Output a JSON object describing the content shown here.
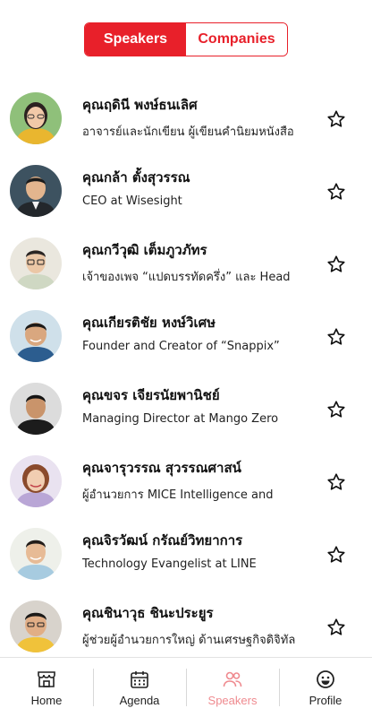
{
  "segment": {
    "speakers_label": "Speakers",
    "companies_label": "Companies"
  },
  "speakers": [
    {
      "name": "คุณฤดินี พงษ์ธนเลิศ",
      "desc": "อาจารย์และนักเขียน ผู้เขียนคำนิยมหนังสือ",
      "icon": "avatar-woman-glasses"
    },
    {
      "name": "คุณกล้า ตั้งสุวรรณ",
      "desc": "CEO at Wisesight",
      "icon": "avatar-man-suit"
    },
    {
      "name": "คุณกวีวุฒิ เต็มภูวภัทร",
      "desc": "เจ้าของเพจ “แปดบรรทัดครึ่ง” และ Head",
      "icon": "avatar-man-glasses"
    },
    {
      "name": "คุณเกียรติชัย หงษ์วิเศษ",
      "desc": "Founder and Creator of “Snappix”",
      "icon": "avatar-man-smiling"
    },
    {
      "name": "คุณขจร เจียรนัยพานิชย์",
      "desc": "Managing Director at Mango Zero",
      "icon": "avatar-man-dark"
    },
    {
      "name": "คุณจารุวรรณ สุวรรณศาสน์",
      "desc": "ผู้อำนวยการ MICE Intelligence and",
      "icon": "avatar-woman-smiling"
    },
    {
      "name": "คุณจิรวัฒน์ กรัณย์วิทยาการ",
      "desc": "Technology Evangelist at LINE",
      "icon": "avatar-man-casual"
    },
    {
      "name": "คุณชินาวุธ ชินะประยูร",
      "desc": "ผู้ช่วยผู้อำนวยการใหญ่ ด้านเศรษฐกิจดิจิทัล",
      "icon": "avatar-man-yellow-shirt"
    }
  ],
  "tabs": [
    {
      "label": "Home",
      "icon": "store-icon"
    },
    {
      "label": "Agenda",
      "icon": "calendar-icon"
    },
    {
      "label": "Speakers",
      "icon": "people-icon"
    },
    {
      "label": "Profile",
      "icon": "smiley-icon"
    }
  ],
  "colors": {
    "accent": "#e8202a",
    "active_tab": "#ef8a8f"
  }
}
